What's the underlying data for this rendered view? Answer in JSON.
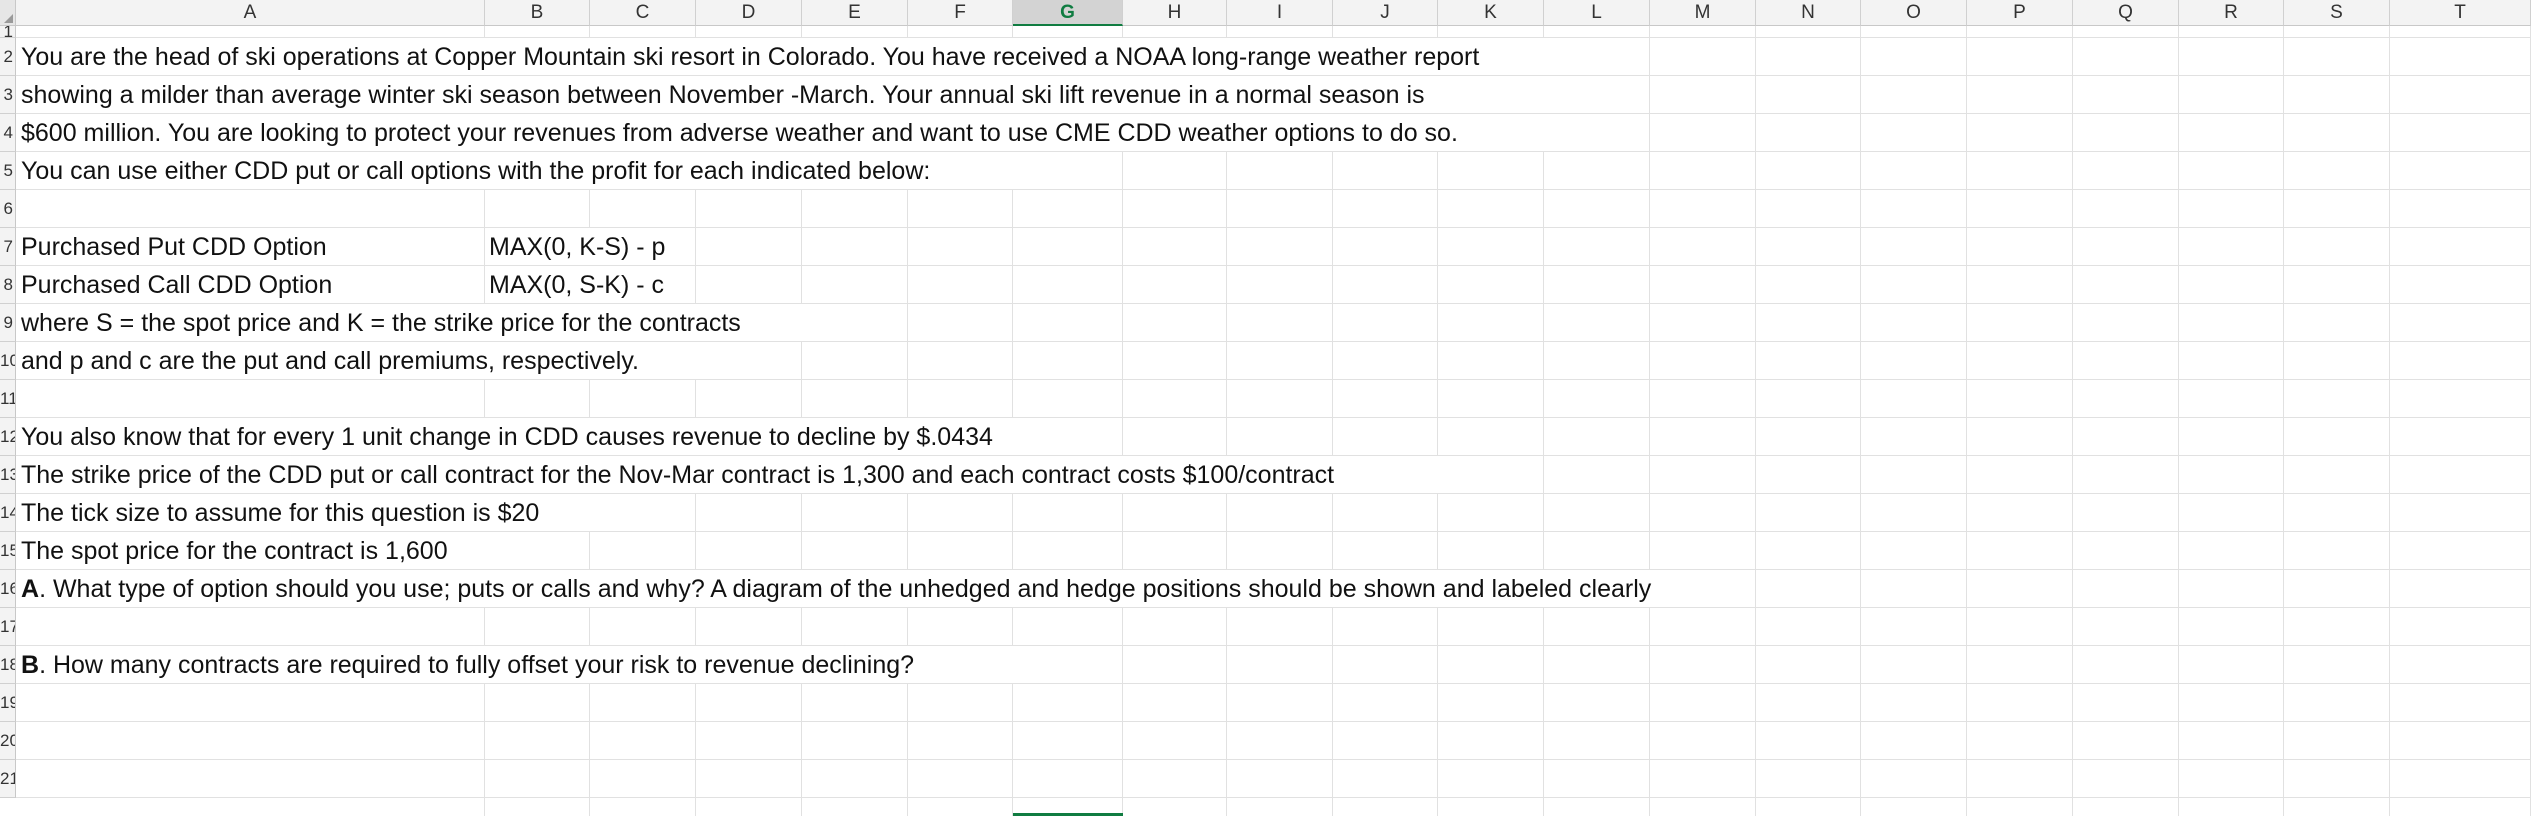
{
  "spreadsheet": {
    "columns": [
      "A",
      "B",
      "C",
      "D",
      "E",
      "F",
      "G",
      "H",
      "I",
      "J",
      "K",
      "L",
      "M",
      "N",
      "O",
      "P",
      "Q",
      "R",
      "S",
      "T"
    ],
    "selected_column": "G",
    "rows": [
      {
        "num": "1",
        "text": "",
        "bold_prefix": ""
      },
      {
        "num": "2",
        "text": "You are the head of ski operations at Copper Mountain ski resort in Colorado.  You have received a NOAA long-range weather report",
        "bold_prefix": ""
      },
      {
        "num": "3",
        "text": "showing a milder than average winter ski season between November -March.  Your annual ski lift revenue in a normal season is",
        "bold_prefix": ""
      },
      {
        "num": "4",
        "text": "$600 million.  You are looking to protect your revenues from adverse weather and want to use CME CDD weather options to do so.",
        "bold_prefix": ""
      },
      {
        "num": "5",
        "text": "You can use either CDD put or call options with the profit for each indicated below:",
        "bold_prefix": ""
      },
      {
        "num": "6",
        "text": "",
        "bold_prefix": ""
      },
      {
        "num": "7",
        "text": "Purchased Put CDD Option",
        "bold_prefix": "",
        "b": "MAX(0, K-S) - p"
      },
      {
        "num": "8",
        "text": "Purchased Call CDD Option",
        "bold_prefix": "",
        "b": "MAX(0, S-K) - c"
      },
      {
        "num": "9",
        "text": "where S = the spot price and K = the strike price for the contracts",
        "bold_prefix": ""
      },
      {
        "num": "10",
        "text": "and p and c are the put and call premiums, respectively.",
        "bold_prefix": ""
      },
      {
        "num": "11",
        "text": "",
        "bold_prefix": ""
      },
      {
        "num": "12",
        "text": "You also know that for every 1 unit change in CDD  causes revenue to decline by $.0434",
        "bold_prefix": ""
      },
      {
        "num": "13",
        "text": "The strike price of the CDD put or call contract for the Nov-Mar contract is 1,300 and each contract costs $100/contract",
        "bold_prefix": ""
      },
      {
        "num": "14",
        "text": "The tick size to assume for this question is $20",
        "bold_prefix": ""
      },
      {
        "num": "15",
        "text": "The spot price for the contract is 1,600",
        "bold_prefix": ""
      },
      {
        "num": "16",
        "text": ".  What type of option should you use; puts or calls and why?  A diagram of the unhedged and hedge positions should be shown and labeled clearly",
        "bold_prefix": "A"
      },
      {
        "num": "17",
        "text": "",
        "bold_prefix": ""
      },
      {
        "num": "18",
        "text": ".  How many contracts are required to fully offset your risk to revenue declining?",
        "bold_prefix": "B"
      },
      {
        "num": "19",
        "text": "",
        "bold_prefix": ""
      },
      {
        "num": "20",
        "text": "",
        "bold_prefix": ""
      },
      {
        "num": "21",
        "text": "",
        "bold_prefix": ""
      }
    ]
  },
  "colors": {
    "grid": "#e1e1e1",
    "header_bg": "#f3f3f3",
    "selected_header_bg": "#d3d3d3",
    "accent": "#107c41"
  }
}
